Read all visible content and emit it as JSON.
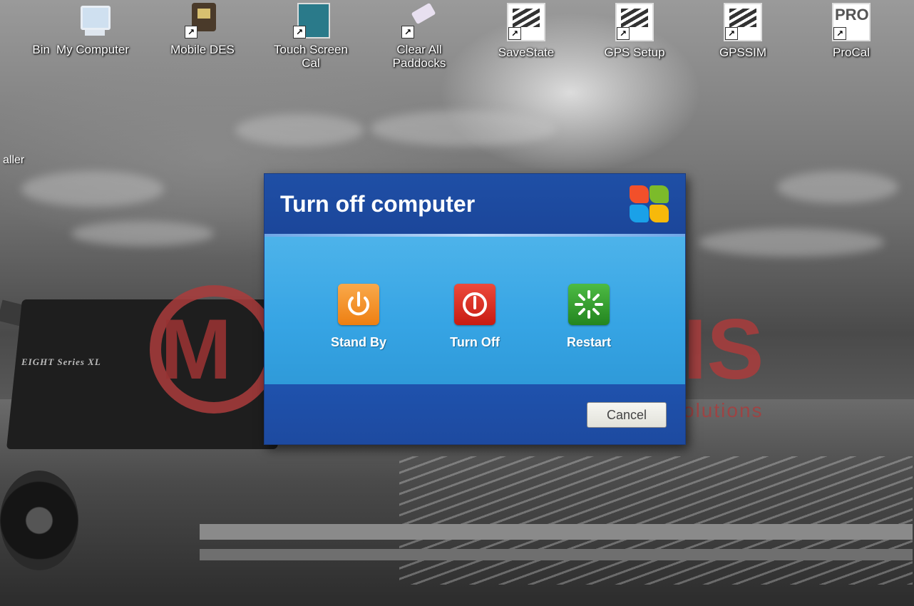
{
  "desktop": {
    "edge_icon_label": "Bin",
    "edge_side_label": "aller",
    "icons": [
      {
        "label": "My Computer",
        "icon": "my-computer-icon"
      },
      {
        "label": "Mobile DES",
        "icon": "mobile-des-icon"
      },
      {
        "label": "Touch Screen Cal",
        "icon": "touch-screen-cal-icon"
      },
      {
        "label": "Clear All Paddocks",
        "icon": "clear-all-paddocks-icon"
      },
      {
        "label": "SaveState",
        "icon": "pcon-icon"
      },
      {
        "label": "GPS Setup",
        "icon": "pcon-icon"
      },
      {
        "label": "GPSSIM",
        "icon": "pcon-icon"
      },
      {
        "label": "ProCal",
        "icon": "procal-icon"
      }
    ],
    "wallpaper": {
      "logo_left": "M",
      "logo_right": "IS",
      "logo_tagline": "olutions",
      "machine_text": "EIGHT Series XL"
    },
    "shortcut_glyph": "↗",
    "pro_badge": "PRO"
  },
  "dialog": {
    "title": "Turn off computer",
    "options": [
      {
        "label": "Stand By",
        "icon": "standby-icon",
        "color": "#f28a1e"
      },
      {
        "label": "Turn Off",
        "icon": "power-off-icon",
        "color": "#d7261b"
      },
      {
        "label": "Restart",
        "icon": "restart-icon",
        "color": "#2f9a2a"
      }
    ],
    "cancel_label": "Cancel"
  },
  "colors": {
    "dialog_header": "#1f4fa6",
    "dialog_body": "#3fabe7",
    "dialog_footer": "#1f52ad"
  }
}
